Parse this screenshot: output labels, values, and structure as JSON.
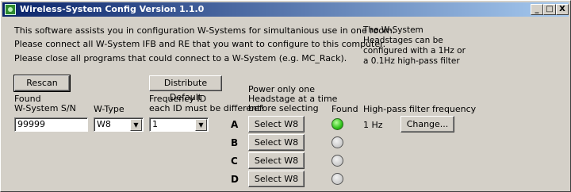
{
  "window": {
    "title": "Wireless-System Config Version 1.1.0",
    "minimize": "_",
    "maximize": "□",
    "close": "X"
  },
  "info": {
    "line1": "This software assists you in configuration W-Systems for simultanious use in one room.",
    "line2": "Please connect all W-System IFB and RE that you want to configure to this computer.",
    "line3": "Please close all programs that could connect to a W-System (e.g. MC_Rack).",
    "side_note": "The W-System Headstages can be configured with a 1Hz or a 0.1Hz high-pass filter"
  },
  "buttons": {
    "rescan": "Rescan",
    "distribute_default": "Distribute Default",
    "change": "Change..."
  },
  "headers": {
    "found_sn": "Found\nW-System S/N",
    "w_type": "W-Type",
    "frequency_id": "Frequency ID\neach ID must be different!",
    "power_note": "Power only one\nHeadstage at a time\nbefore selecting",
    "found": "Found",
    "highpass": "High-pass filter frequency"
  },
  "fields": {
    "serial_number": "99999",
    "w_type": "W8",
    "frequency_id": "1",
    "highpass_value": "1 Hz"
  },
  "rows": [
    {
      "letter": "A",
      "button": "Select W8",
      "found": true
    },
    {
      "letter": "B",
      "button": "Select W8",
      "found": false
    },
    {
      "letter": "C",
      "button": "Select W8",
      "found": false
    },
    {
      "letter": "D",
      "button": "Select W8",
      "found": false
    }
  ],
  "colors": {
    "title_bar_start": "#0a246a",
    "title_bar_end": "#a6caf0",
    "face": "#d4d0c8",
    "led_on": "#2fc11a",
    "led_off": "#c8c8c8"
  }
}
